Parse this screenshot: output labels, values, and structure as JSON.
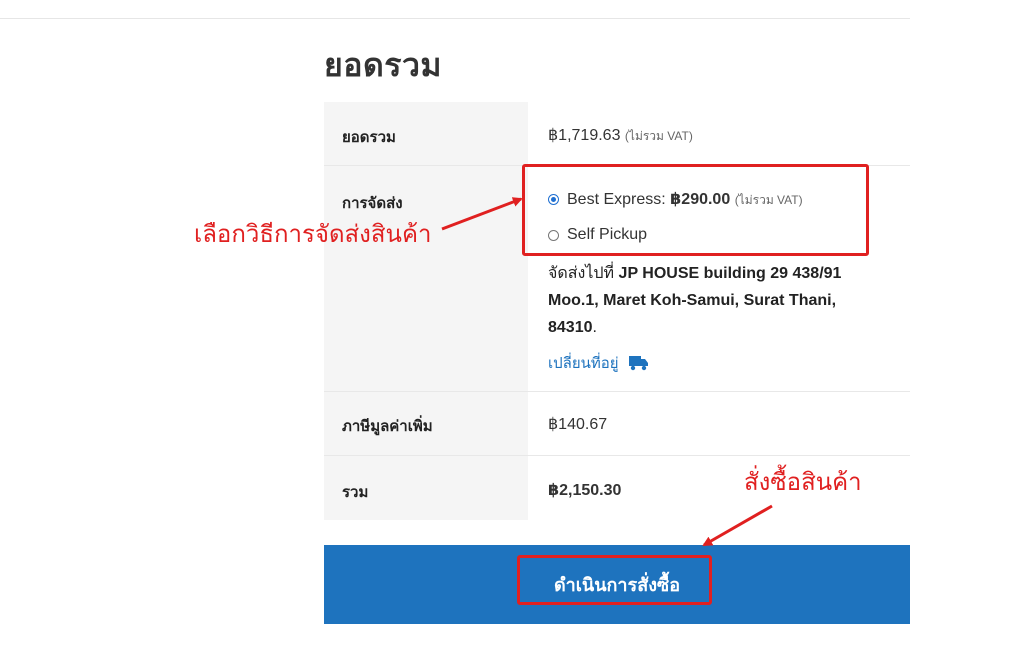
{
  "heading": "ยอดรวม",
  "rows": {
    "subtotal": {
      "label": "ยอดรวม",
      "amount": "฿1,719.63",
      "note": "(ไม่รวม VAT)"
    },
    "shipping": {
      "label": "การจัดส่ง",
      "options": [
        {
          "name": "Best Express:",
          "price": "฿290.00",
          "note": "(ไม่รวม VAT)",
          "selected": true
        },
        {
          "name": "Self Pickup",
          "selected": false
        }
      ],
      "dest_prefix": "จัดส่งไปที่",
      "dest_address": "JP HOUSE building 29 438/91 Moo.1, Maret Koh-Samui, Surat Thani, 84310",
      "dest_suffix": ".",
      "change_address": "เปลี่ยนที่อยู่"
    },
    "tax": {
      "label": "ภาษีมูลค่าเพิ่ม",
      "amount": "฿140.67"
    },
    "total": {
      "label": "รวม",
      "amount": "฿2,150.30"
    }
  },
  "checkout_button": "ดำเนินการสั่งซื้อ",
  "annotations": {
    "choose_shipping": "เลือกวิธีการจัดส่งสินค้า",
    "place_order": "สั่งซื้อสินค้า",
    "color": "#e02020"
  },
  "icons": {
    "change_address": "truck-icon"
  },
  "colors": {
    "accent": "#1e73be"
  }
}
